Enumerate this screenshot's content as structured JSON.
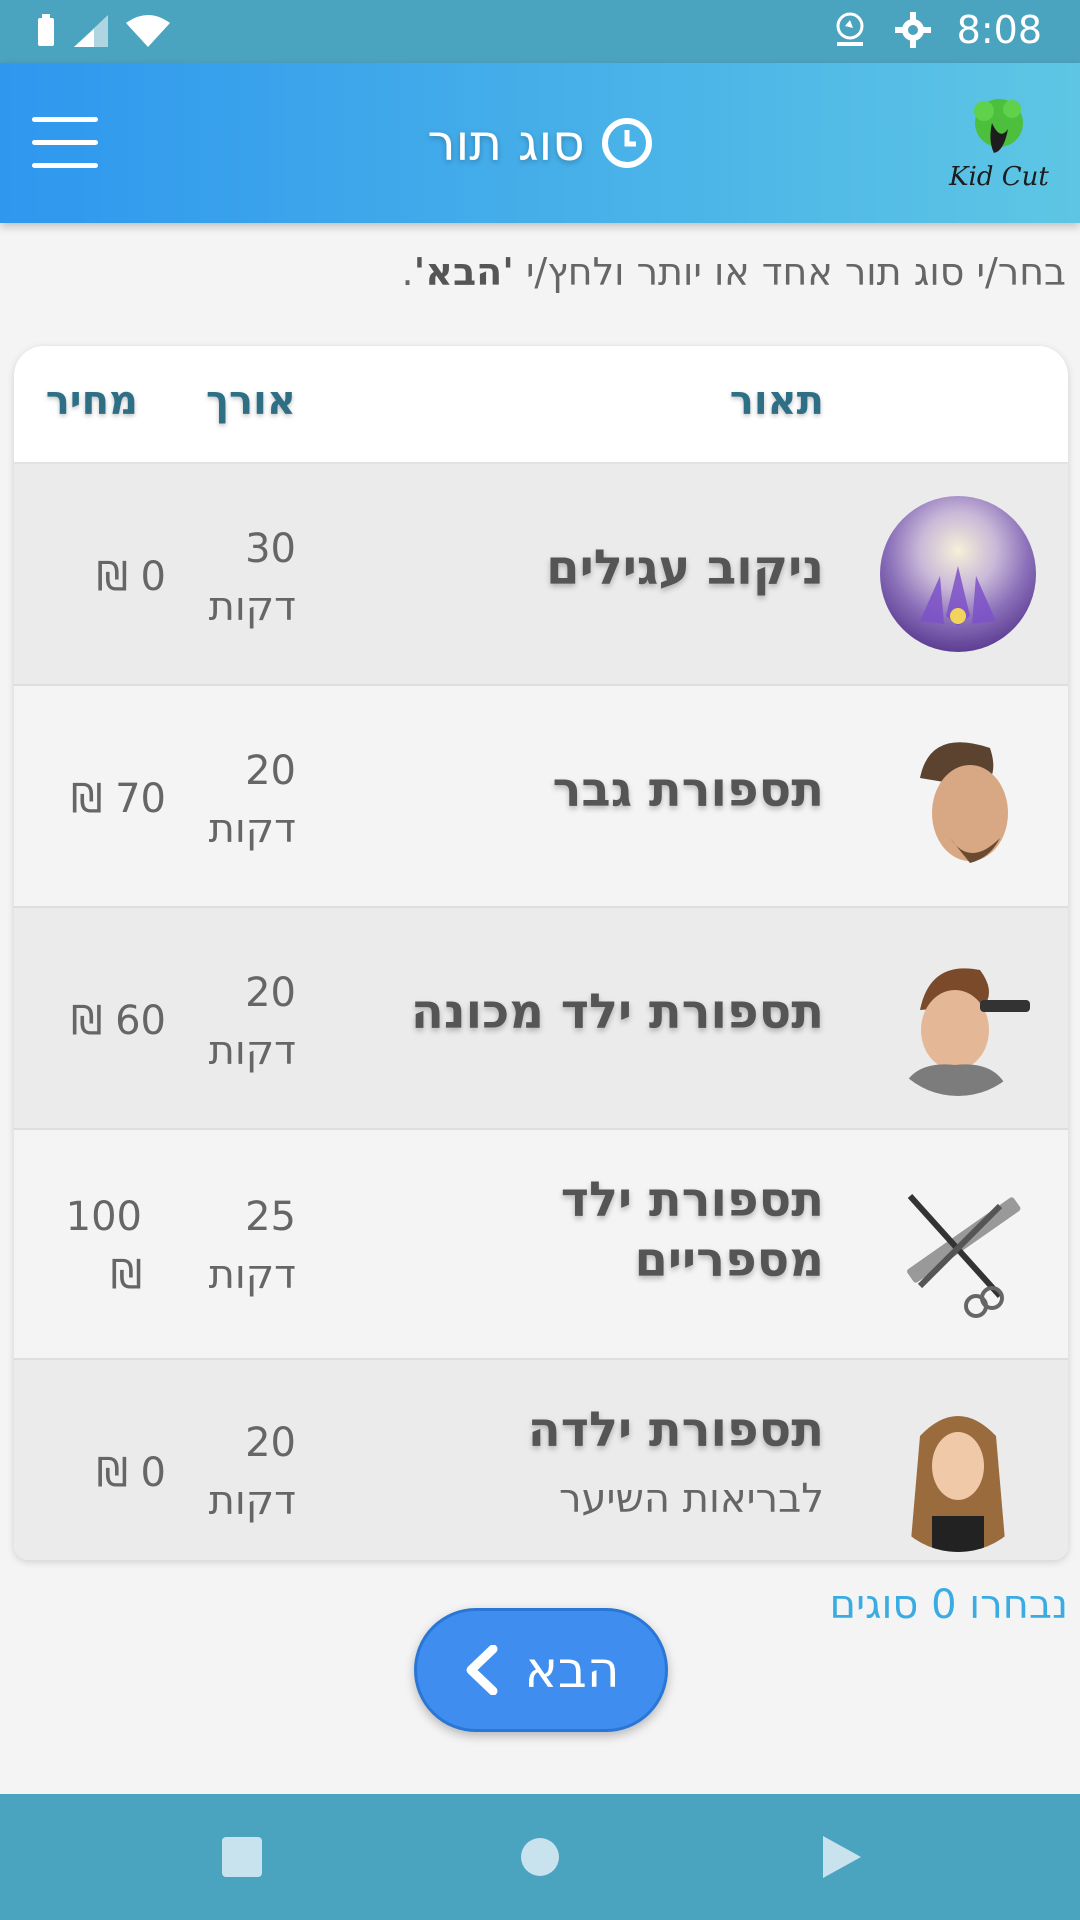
{
  "status_bar": {
    "time": "8:08",
    "icons": [
      "battery-icon",
      "signal-icon",
      "wifi-icon",
      "app-notification-icon",
      "settings-icon"
    ],
    "color": "#4aa3bf"
  },
  "app_bar": {
    "title": "סוג תור",
    "title_icon": "clock-icon",
    "menu_icon": "hamburger-menu-icon",
    "logo_text": "Kid Cut",
    "gradient": [
      "#2f97ee",
      "#5ec6e4"
    ]
  },
  "instruction": {
    "prefix": "בחר/י סוג תור אחד או יותר ולחץ/י ",
    "emphasis": "'הבא'",
    "suffix": "."
  },
  "table": {
    "headers": {
      "description": "תאור",
      "length": "אורך",
      "price": "מחיר"
    },
    "header_color": "#2f6f86",
    "rows": [
      {
        "title": "ניקוב עגילים",
        "subtitle": "",
        "duration": "30",
        "duration_unit": "דקות",
        "price": "0 ₪",
        "image": "lotus-flower-image"
      },
      {
        "title": "תספורת גבר",
        "subtitle": "",
        "duration": "20",
        "duration_unit": "דקות",
        "price": "70 ₪",
        "image": "man-haircut-image"
      },
      {
        "title": "תספורת ילד מכונה",
        "subtitle": "",
        "duration": "20",
        "duration_unit": "דקות",
        "price": "60 ₪",
        "image": "boy-haircut-image"
      },
      {
        "title": "תספורת ילד מספריים",
        "subtitle": "",
        "duration": "25",
        "duration_unit": "דקות",
        "price": "100 ₪",
        "image": "scissors-comb-image"
      },
      {
        "title": "תספורת ילדה",
        "subtitle": "לבריאות השיער",
        "duration": "20",
        "duration_unit": "דקות",
        "price": "0 ₪",
        "image": "girl-long-hair-image"
      }
    ]
  },
  "selected_count": "נבחרו 0 סוגים",
  "next_button": {
    "label": "הבא",
    "icon": "chevron-left-icon",
    "color": "#3f8eef"
  },
  "nav_bar": {
    "icons": [
      "recent-apps-square-icon",
      "home-circle-icon",
      "back-triangle-icon"
    ]
  }
}
